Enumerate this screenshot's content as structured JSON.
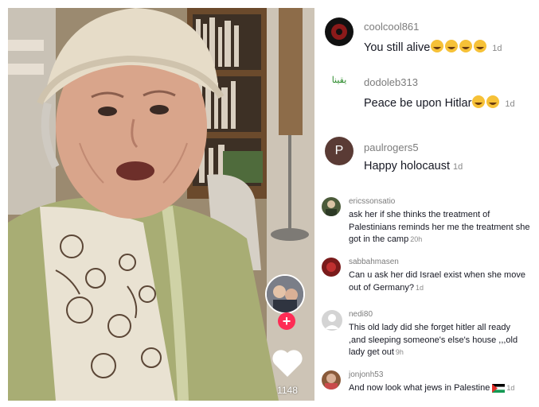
{
  "video": {
    "like_count": "1148"
  },
  "comments": [
    {
      "username": "coolcool861",
      "text": "You still alive",
      "emoji_count": 4,
      "time": "1d"
    },
    {
      "username": "dodoleb313",
      "avatar_text": "يقينا",
      "text": "Peace be upon Hitlar",
      "emoji_count": 2,
      "time": "1d"
    },
    {
      "username": "paulrogers5",
      "avatar_letter": "P",
      "text": "Happy holocaust",
      "time": "1d"
    },
    {
      "username": "ericssonsatio",
      "text": "ask her if she thinks the treatment of Palestinians reminds her me the treatment she got in the camp",
      "time": "20h"
    },
    {
      "username": "sabbahmasen",
      "text": "Can u ask her did Israel exist when she move out of Germany?",
      "time": "1d"
    },
    {
      "username": "nedi80",
      "text": "This old lady did she forget hitler all ready ,and sleeping someone's else's house ,,,old lady get out",
      "time": "9h"
    },
    {
      "username": "jonjonh53",
      "text": "And now look what jews in Palestine",
      "flag": "palestine-flag",
      "time": "1d"
    }
  ],
  "colors": {
    "follow": "#fe2c55",
    "username": "#7c7c7c",
    "comment_text": "#161823",
    "time": "#8a8a8a"
  }
}
